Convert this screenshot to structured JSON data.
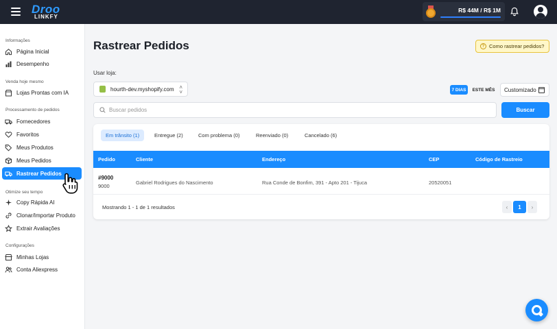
{
  "topbar": {
    "logo_top": "Droo",
    "logo_bottom": "LINKFY",
    "revenue": "R$ 44M / R$ 1M"
  },
  "sidebar": {
    "sections": [
      {
        "title": "Informações",
        "items": [
          {
            "label": "Página Inicial",
            "icon": "home-icon"
          },
          {
            "label": "Desempenho",
            "icon": "chart-bars-icon"
          }
        ]
      },
      {
        "title": "Venda hoje mesmo",
        "items": [
          {
            "label": "Lojas Prontas com IA",
            "icon": "store-ai-icon"
          }
        ]
      },
      {
        "title": "Processamento de pedidos",
        "items": [
          {
            "label": "Fornecedores",
            "icon": "truck-icon"
          },
          {
            "label": "Favoritos",
            "icon": "heart-icon"
          },
          {
            "label": "Meus Produtos",
            "icon": "tag-icon"
          },
          {
            "label": "Meus Pedidos",
            "icon": "box-icon"
          },
          {
            "label": "Rastrear Pedidos",
            "icon": "tracking-truck-icon",
            "active": true
          }
        ]
      },
      {
        "title": "Otimize seu tempo",
        "items": [
          {
            "label": "Copy Rápida AI",
            "icon": "sparkle-icon"
          },
          {
            "label": "Clonar/Importar Produto",
            "icon": "link-icon"
          },
          {
            "label": "Extrair Avaliações",
            "icon": "star-icon"
          }
        ]
      },
      {
        "title": "Configurações",
        "items": [
          {
            "label": "Minhas Lojas",
            "icon": "store-icon"
          },
          {
            "label": "Conta Aliexpress",
            "icon": "users-icon"
          }
        ]
      }
    ]
  },
  "main": {
    "title": "Rastrear Pedidos",
    "help_label": "Como rastrear pedidos?",
    "store_label": "Usar loja:",
    "store_value": "hourth-dev.myshopify.com",
    "period_days": "7 DIAS",
    "period_month": "ESTE MÊS",
    "custom_label": "Customizado",
    "search_placeholder": "Buscar pedidos",
    "search_button": "Buscar",
    "tabs": [
      {
        "label": "Em trânsito (1)",
        "active": true
      },
      {
        "label": "Entregue (2)"
      },
      {
        "label": "Com problema (0)"
      },
      {
        "label": "Reenviado (0)"
      },
      {
        "label": "Cancelado (6)"
      }
    ],
    "table": {
      "headers": [
        "Pedido",
        "Cliente",
        "Endereço",
        "CEP",
        "Código de Rastreio"
      ],
      "rows": [
        {
          "order": "#9000",
          "order_id": "9000",
          "client": "Gabriel Rodrigues do Nascimento",
          "address": "Rua Conde de Bonfim, 391 - Apto 201 - Tijuca",
          "cep": "20520051",
          "tracking": ""
        }
      ]
    },
    "footer": "Mostrando 1 - 1 de 1 resultados",
    "pagination": {
      "prev": "‹",
      "current": "1",
      "next": "›"
    }
  },
  "colors": {
    "accent": "#1a8cff",
    "topbar": "#1f2430",
    "help_bg": "#fff7c9"
  }
}
